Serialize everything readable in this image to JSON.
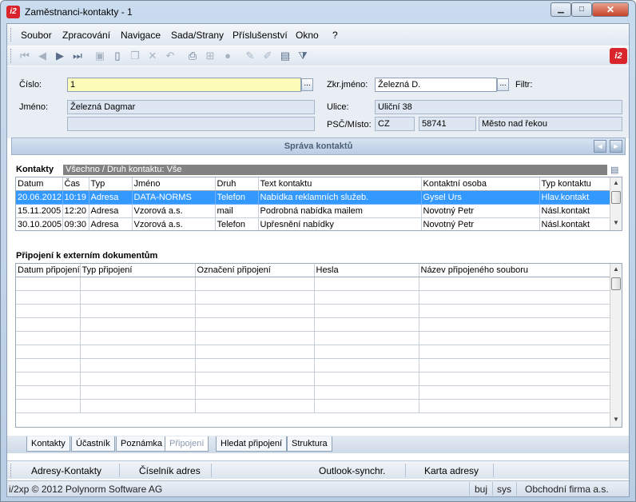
{
  "window": {
    "title": "Zaměstnanci-kontakty - 1",
    "app_icon_text": "i2"
  },
  "menu": [
    "Soubor",
    "Zpracování",
    "Navigace",
    "Sada/Strany",
    "Příslušenství",
    "Okno",
    "?"
  ],
  "form": {
    "cislo_label": "Číslo:",
    "cislo_value": "1",
    "jmeno_label": "Jméno:",
    "jmeno_value": "Železná Dagmar",
    "jmeno2_value": "",
    "zkr_label": "Zkr.jméno:",
    "zkr_value": "Železná D.",
    "filtr_label": "Filtr:",
    "ulice_label": "Ulice:",
    "ulice_value": "Uliční 38",
    "psc_label": "PSČ/Místo:",
    "country": "CZ",
    "psc": "58741",
    "mesto": "Město nad řekou",
    "ellipsis": "..."
  },
  "panel": {
    "title": "Správa kontaktů",
    "prev": "◄",
    "next": "►"
  },
  "kontakty": {
    "label": "Kontakty",
    "filter": "Všechno / Druh kontaktu: Vše",
    "columns": [
      "Datum",
      "Čas",
      "Typ",
      "Jméno",
      "Druh",
      "Text kontaktu",
      "Kontaktní osoba",
      "Typ kontaktu"
    ],
    "rows": [
      [
        "20.06.2012",
        "10:19",
        "Adresa",
        "DATA-NORMS",
        "Telefon",
        "Nabídka reklamních služeb.",
        "Gysel Urs",
        "Hlav.kontakt"
      ],
      [
        "15.11.2005",
        "12:20",
        "Adresa",
        "Vzorová a.s.",
        "mail",
        "Podrobná nabídka mailem",
        "Novotný Petr",
        "Násl.kontakt"
      ],
      [
        "30.10.2005",
        "09:30",
        "Adresa",
        "Vzorová a.s.",
        "Telefon",
        "Upřesnění nabídky",
        "Novotný Petr",
        "Násl.kontakt"
      ]
    ],
    "selected_row": 0
  },
  "pripojeni": {
    "label": "Připojení k externím dokumentům",
    "columns": [
      "Datum připojení",
      "Typ připojení",
      "Označení připojení",
      "Hesla",
      "Název připojeného souboru"
    ],
    "empty_rows": 10
  },
  "tabs": [
    "Kontakty",
    "Účastník",
    "Poznámka",
    "Připojení",
    "Hledat připojení",
    "Struktura"
  ],
  "active_tab": "Připojení",
  "bottom_buttons": [
    "Adresy-Kontakty",
    "Číselník adres",
    "Outlook-synchr.",
    "Karta adresy"
  ],
  "status": {
    "copyright": "i/2xp © 2012 Polynorm Software AG",
    "user": "buj",
    "sys": "sys",
    "company": "Obchodní firma a.s."
  },
  "colors": {
    "selection": "#3399ff",
    "required_field": "#fdfbb8",
    "logo": "#d8242a"
  }
}
